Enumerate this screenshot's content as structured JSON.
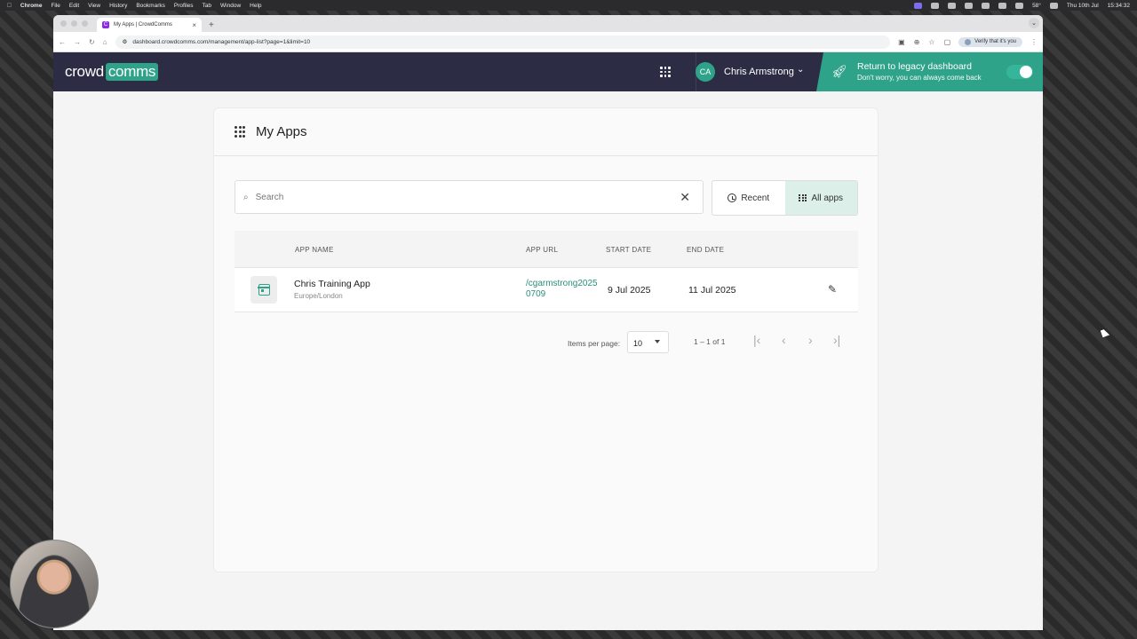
{
  "menubar": {
    "app": "Chrome",
    "items": [
      "File",
      "Edit",
      "View",
      "History",
      "Bookmarks",
      "Profiles",
      "Tab",
      "Window",
      "Help"
    ],
    "temperature": "58°",
    "date": "Thu 10th Jul",
    "time": "15:34:32"
  },
  "browser": {
    "tab_title": "My Apps | CrowdComms",
    "tab_favicon": "C",
    "url": "dashboard.crowdcomms.com/management/app-list?page=1&limit=10",
    "verify_label": "Verify that it's you"
  },
  "header": {
    "logo_crowd": "crowd",
    "logo_comms": "comms",
    "user_initials": "CA",
    "user_name": "Chris Armstrong",
    "legacy_title": "Return to legacy dashboard",
    "legacy_subtitle": "Don't worry, you can always come back",
    "accent_color": "#2fa38a",
    "header_color": "#2c2d45"
  },
  "page": {
    "title": "My Apps",
    "search_placeholder": "Search",
    "filter_recent": "Recent",
    "filter_all": "All apps"
  },
  "table": {
    "columns": [
      "APP NAME",
      "APP URL",
      "START DATE",
      "END DATE"
    ],
    "rows": [
      {
        "name": "Chris Training App",
        "timezone": "Europe/London",
        "url": "/cgarmstrong20250709",
        "start": "9 Jul 2025",
        "end": "11 Jul 2025"
      }
    ]
  },
  "pagination": {
    "items_per_page_label": "Items per page:",
    "items_per_page": "10",
    "range": "1 – 1 of 1"
  }
}
